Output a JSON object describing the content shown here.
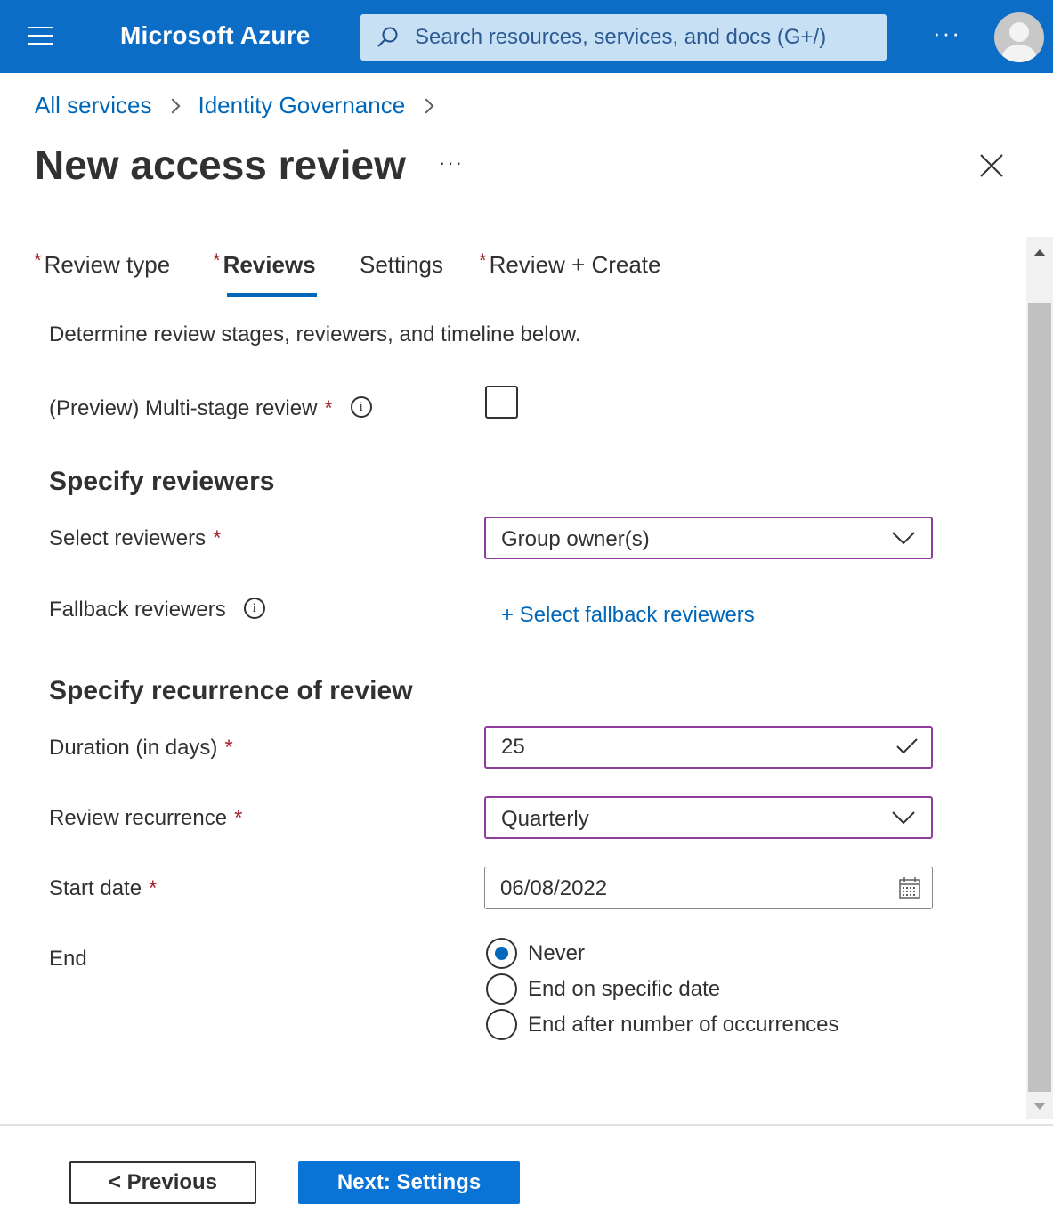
{
  "header": {
    "brand": "Microsoft Azure",
    "search_placeholder": "Search resources, services, and docs (G+/)",
    "more": "···"
  },
  "breadcrumb": [
    "All services",
    "Identity Governance"
  ],
  "page": {
    "title": "New access review",
    "title_more": "···"
  },
  "tabs": [
    {
      "label": "Review type",
      "required": true,
      "active": false
    },
    {
      "label": "Reviews",
      "required": true,
      "active": true
    },
    {
      "label": "Settings",
      "required": false,
      "active": false
    },
    {
      "label": "Review + Create",
      "required": true,
      "active": false
    }
  ],
  "form": {
    "intro": "Determine review stages, reviewers, and timeline below.",
    "multistage_label": "(Preview) Multi-stage review",
    "multistage_checked": false,
    "section_reviewers": "Specify reviewers",
    "select_reviewers_label": "Select reviewers",
    "select_reviewers_value": "Group owner(s)",
    "fallback_label": "Fallback reviewers",
    "fallback_link": "+ Select fallback reviewers",
    "section_recurrence": "Specify recurrence of review",
    "duration_label": "Duration (in days)",
    "duration_value": "25",
    "recurrence_label": "Review recurrence",
    "recurrence_value": "Quarterly",
    "start_label": "Start date",
    "start_value": "06/08/2022",
    "end_label": "End",
    "end_options": [
      {
        "label": "Never",
        "checked": true
      },
      {
        "label": "End on specific date",
        "checked": false
      },
      {
        "label": "End after number of occurrences",
        "checked": false
      }
    ]
  },
  "footer": {
    "previous": "< Previous",
    "next": "Next: Settings"
  },
  "colors": {
    "topbar": "#0c6dc7",
    "link": "#0067b8",
    "required": "#a4262c",
    "focus_border": "#8e3d9c",
    "primary_button": "#0a74d6"
  }
}
